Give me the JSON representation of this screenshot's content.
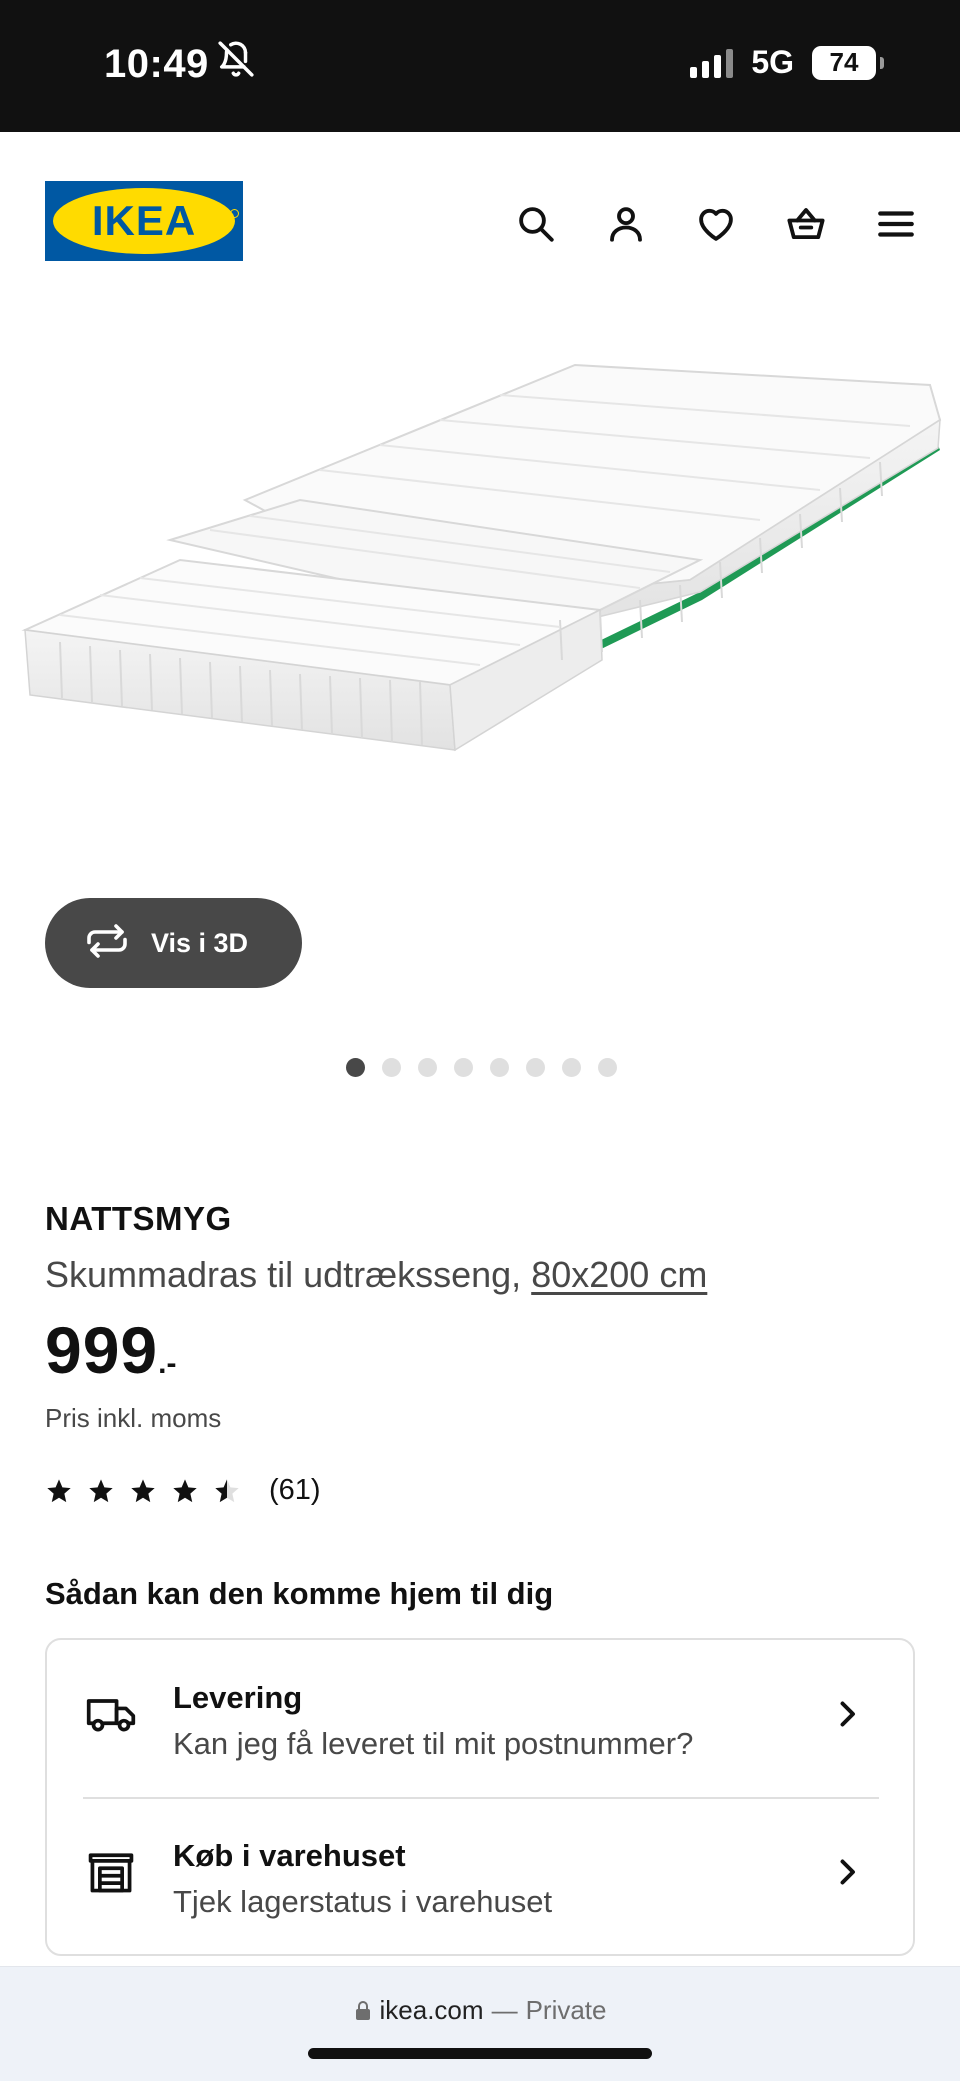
{
  "status_bar": {
    "time": "10:49",
    "network": "5G",
    "battery": "74",
    "icons": [
      "bell-slash-icon",
      "signal-icon",
      "battery-icon"
    ]
  },
  "header": {
    "logo_text": "IKEA",
    "icons": [
      "search-icon",
      "account-icon",
      "heart-icon",
      "basket-icon",
      "menu-icon"
    ],
    "brand_colors": {
      "blue": "#0058a3",
      "yellow": "#ffdb00"
    }
  },
  "gallery": {
    "view_3d_label": "Vis i 3D",
    "dots_total": 8,
    "active_dot": 1
  },
  "product": {
    "name": "NATTSMYG",
    "description": "Skummadras til udtræksseng,",
    "size": "80x200 cm",
    "price_integer": "999",
    "price_decimal": ".-",
    "price_note": "Pris inkl. moms",
    "rating": 4.5,
    "rating_max": 5,
    "rating_count": "(61)"
  },
  "delivery": {
    "title": "Sådan kan den komme hjem til dig",
    "options": [
      {
        "icon": "truck-icon",
        "title": "Levering",
        "subtitle": "Kan jeg få leveret til mit postnummer?"
      },
      {
        "icon": "store-icon",
        "title": "Køb i varehuset",
        "subtitle": "Tjek lagerstatus i varehuset"
      }
    ]
  },
  "browser": {
    "domain": "ikea.com",
    "separator": "—",
    "mode": "Private"
  },
  "colors": {
    "text": "#111111",
    "secondary_text": "#484848",
    "button_dark": "#484848",
    "border": "#dfdfdf"
  }
}
